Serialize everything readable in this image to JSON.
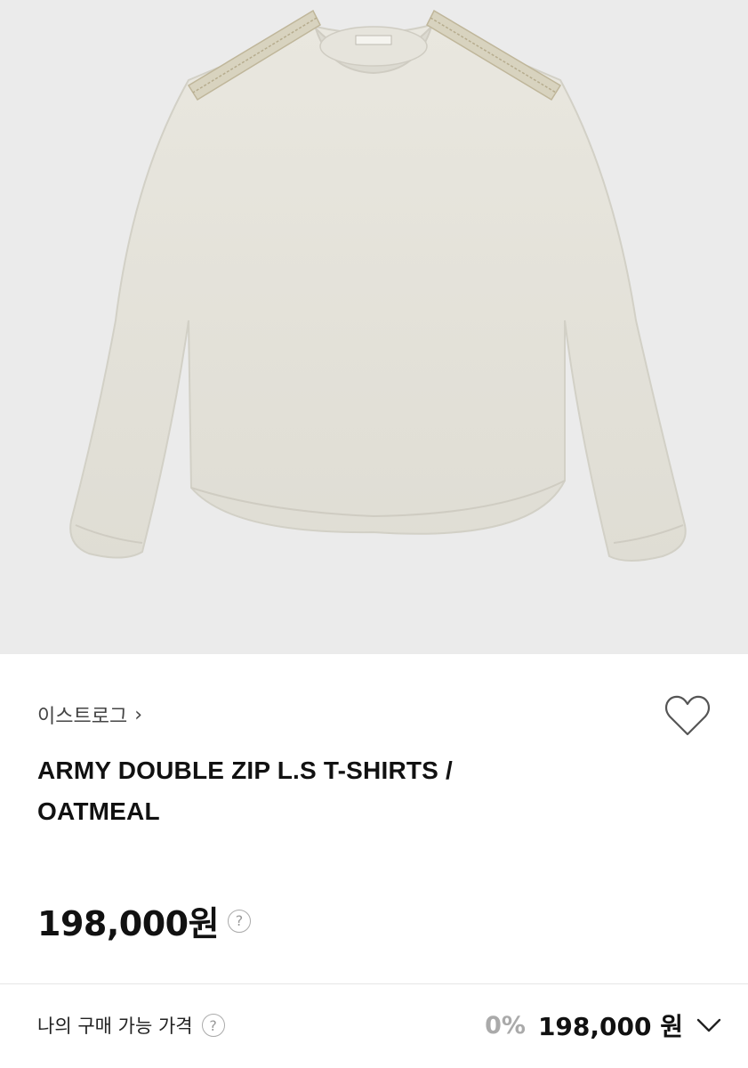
{
  "product": {
    "image_alt": "oatmeal long sleeve t-shirt with double zips on shoulders",
    "brand": "이스트로그",
    "brand_chevron": "›",
    "title_lines": [
      "ARMY DOUBLE ZIP L.S T-SHIRTS /",
      "OATMEAL"
    ],
    "price": "198,000원",
    "help_glyph": "?",
    "wishlist_icon": "heart-outline-icon"
  },
  "my_price": {
    "label": "나의 구매 가능 가격",
    "help_glyph": "?",
    "discount": "0%",
    "value": "198,000 원",
    "expand_icon": "chevron-down-icon"
  },
  "colors": {
    "image_bg": "#ebebeb",
    "shirt": "#e6e4dc",
    "text_primary": "#111111",
    "text_muted": "#aaaaaa"
  }
}
